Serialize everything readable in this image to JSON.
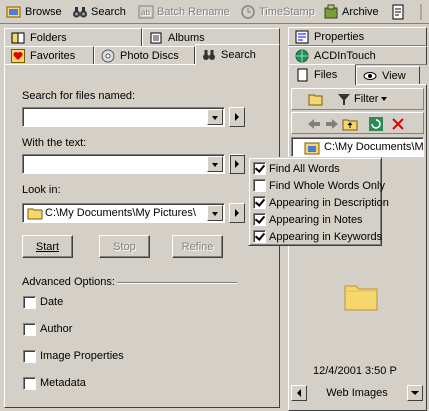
{
  "toolbar": {
    "browse": "Browse",
    "search": "Search",
    "batch_rename": "Batch Rename",
    "timestamp": "TimeStamp",
    "archive": "Archive"
  },
  "left_tabs": {
    "row1": [
      "Folders",
      "Albums"
    ],
    "row2": [
      "Favorites",
      "Photo Discs",
      "Search"
    ]
  },
  "search_form": {
    "named_label": "Search for files named:",
    "named_value": "",
    "text_label": "With the text:",
    "text_value": "",
    "look_label": "Look in:",
    "look_value": "C:\\My Documents\\My Pictures\\",
    "start": "Start",
    "stop": "Stop",
    "refine": "Refine",
    "advanced_label": "Advanced Options:",
    "options": [
      {
        "label": "Date",
        "checked": false
      },
      {
        "label": "Author",
        "checked": false
      },
      {
        "label": "Image Properties",
        "checked": false
      },
      {
        "label": "Metadata",
        "checked": false
      }
    ]
  },
  "popup_menu": [
    {
      "label": "Find All Words",
      "checked": true
    },
    {
      "label": "Find Whole Words Only",
      "checked": false
    },
    {
      "label": "Appearing in Description",
      "checked": true
    },
    {
      "label": "Appearing in Notes",
      "checked": true
    },
    {
      "label": "Appearing in Keywords",
      "checked": true
    }
  ],
  "right_panel": {
    "tab_properties": "Properties",
    "tab_acdintouch": "ACDInTouch",
    "tab_files": "Files",
    "tab_view": "View",
    "filter_label": "Filter",
    "path": "C:\\My Documents\\My",
    "timestamp": "12/4/2001 3:50 P",
    "bottom_label": "Web Images"
  },
  "colors": {
    "face": "#d4d0c8",
    "shadow": "#808080",
    "highlight": "#ffffff",
    "folder": "#f5d76e"
  }
}
